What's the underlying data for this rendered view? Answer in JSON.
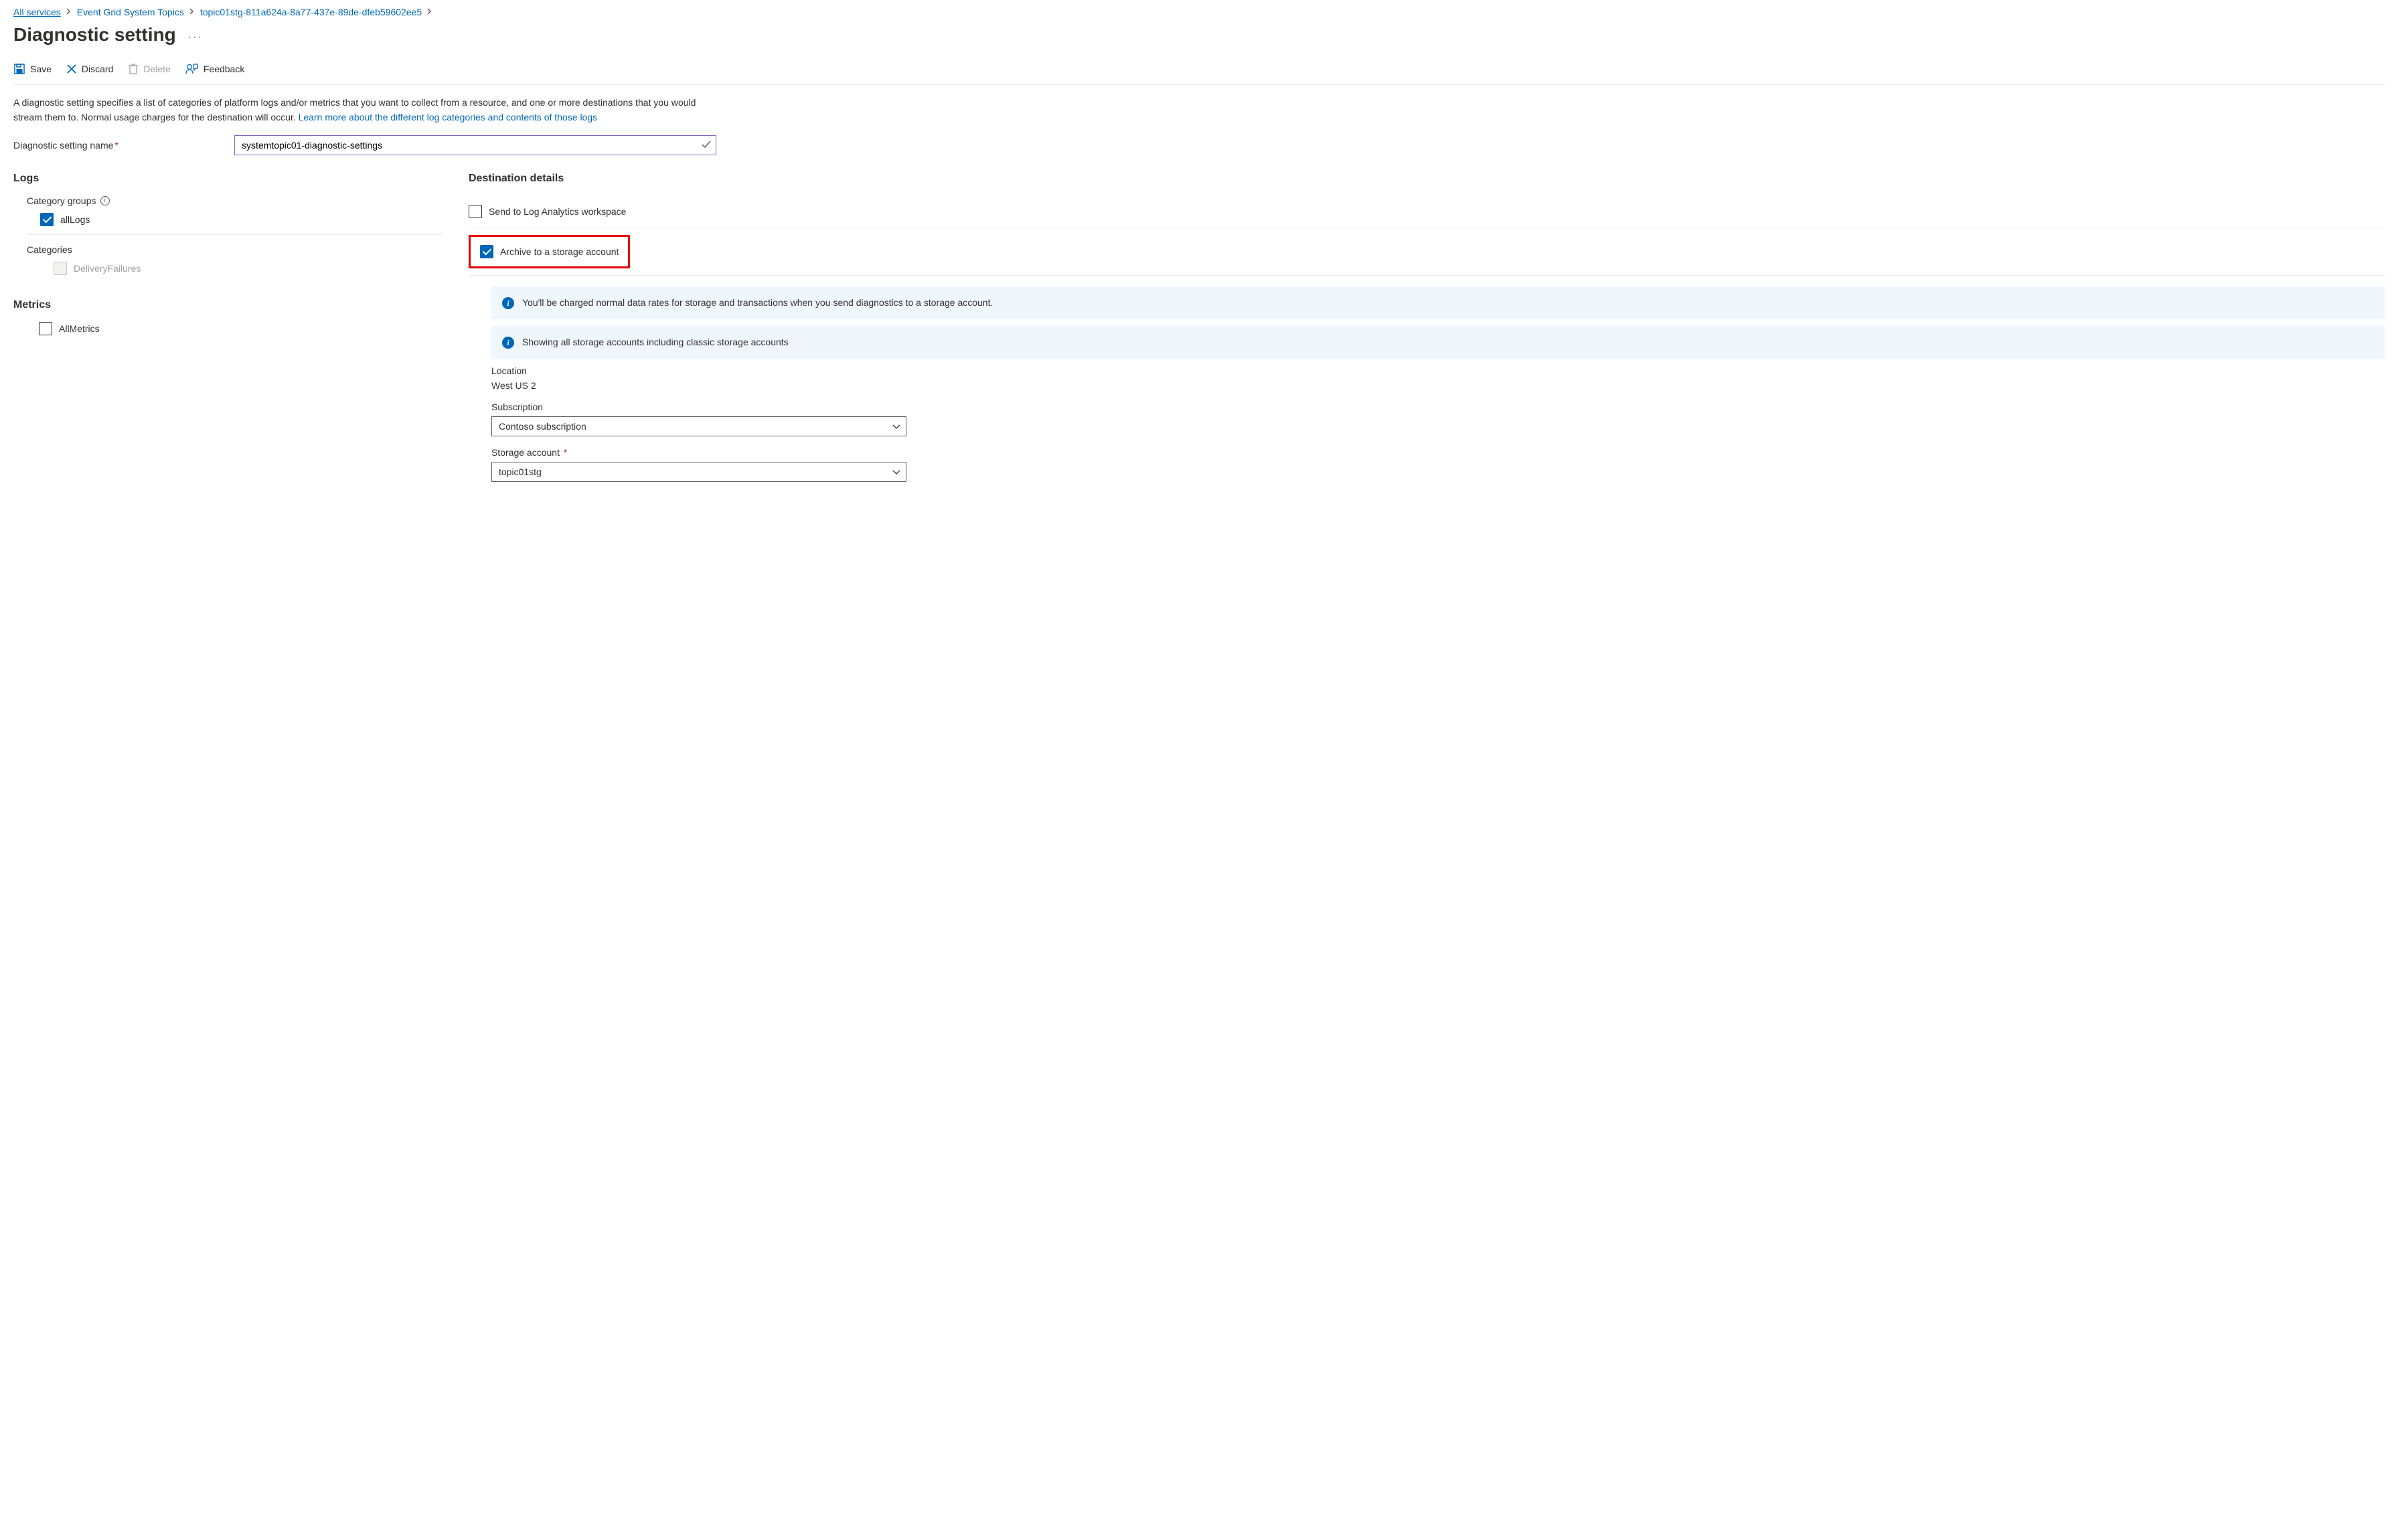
{
  "breadcrumb": {
    "items": [
      {
        "label": "All services",
        "underline": true
      },
      {
        "label": "Event Grid System Topics",
        "underline": false
      },
      {
        "label": "topic01stg-811a624a-8a77-437e-89de-dfeb59602ee5",
        "underline": false
      }
    ]
  },
  "page": {
    "title": "Diagnostic setting",
    "more": "···"
  },
  "toolbar": {
    "save": "Save",
    "discard": "Discard",
    "delete": "Delete",
    "feedback": "Feedback"
  },
  "description": {
    "text": "A diagnostic setting specifies a list of categories of platform logs and/or metrics that you want to collect from a resource, and one or more destinations that you would stream them to. Normal usage charges for the destination will occur. ",
    "link": "Learn more about the different log categories and contents of those logs"
  },
  "nameField": {
    "label": "Diagnostic setting name",
    "value": "systemtopic01-diagnostic-settings"
  },
  "logs": {
    "heading": "Logs",
    "categoryGroupsLabel": "Category groups",
    "allLogs": "allLogs",
    "categoriesLabel": "Categories",
    "deliveryFailures": "DeliveryFailures"
  },
  "metrics": {
    "heading": "Metrics",
    "allMetrics": "AllMetrics"
  },
  "destinations": {
    "heading": "Destination details",
    "sendLogAnalytics": "Send to Log Analytics workspace",
    "archiveStorage": "Archive to a storage account",
    "info1": "You'll be charged normal data rates for storage and transactions when you send diagnostics to a storage account.",
    "info2": "Showing all storage accounts including classic storage accounts",
    "locationLabel": "Location",
    "locationValue": "West US 2",
    "subscriptionLabel": "Subscription",
    "subscriptionValue": "Contoso subscription",
    "storageLabel": "Storage account",
    "storageValue": "topic01stg"
  }
}
